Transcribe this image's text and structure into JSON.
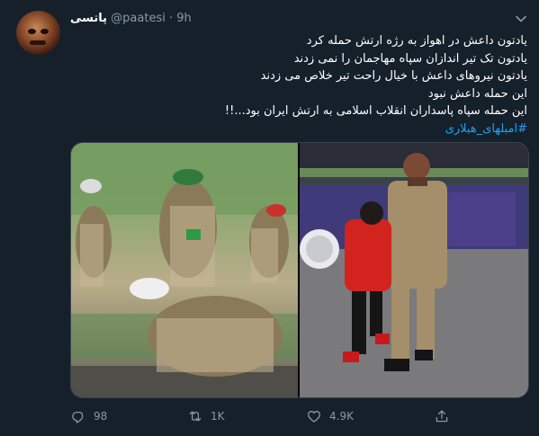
{
  "tweet": {
    "display_name": "پاتسی",
    "handle": "@paatesi",
    "separator": "·",
    "time": "9h",
    "lines": [
      "یادتون داعش در اهواز به رژه ارتش حمله کرد",
      "یادتون تک تیر اندازان سپاه مهاجمان را نمی زدند",
      "یادتون نیروهای داعش با خیال راحت تیر خلاص می زدند",
      "این حمله داعش نبود",
      "این حمله سپاه پاسداران انقلاب اسلامی به ارتش ایران بود...!!"
    ],
    "hashtag": "#امبلهای_هبلاری",
    "media_left_alt": "Soldiers in camouflage crawling and running during the attack",
    "media_right_alt": "A soldier carrying a child in a red jacket away from the parade stand"
  },
  "actions": {
    "reply_count": "98",
    "retweet_count": "1K",
    "like_count": "4.9K"
  },
  "colors": {
    "background": "#15202b",
    "secondary_text": "#8899a6",
    "link": "#1da1f2",
    "divider": "#38444d"
  },
  "icons": {
    "caret": "chevron-down-icon",
    "reply": "reply-icon",
    "retweet": "retweet-icon",
    "like": "heart-icon",
    "share": "share-icon"
  }
}
